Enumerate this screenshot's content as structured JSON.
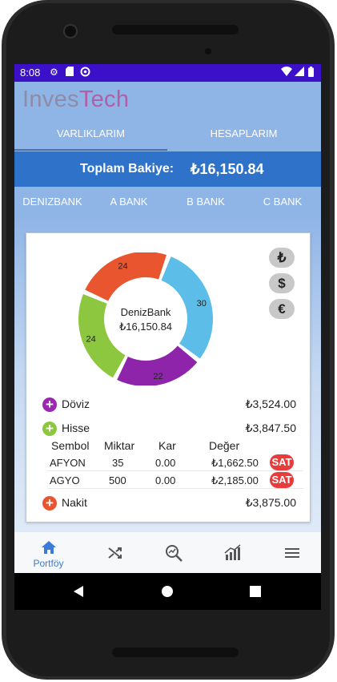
{
  "status_bar": {
    "time": "8:08"
  },
  "app": {
    "logo_part1": "Inves",
    "logo_part2": "Tech"
  },
  "main_tabs": [
    "VARLIKLARIM",
    "HESAPLARIM"
  ],
  "balance": {
    "label": "Toplam Bakiye:",
    "value": "₺16,150.84"
  },
  "bank_tabs": [
    "DENIZBANK",
    "A BANK",
    "B BANK",
    "C BANK"
  ],
  "chart_data": {
    "type": "pie",
    "center_title": "DenizBank",
    "center_value": "₺16,150.84",
    "slices": [
      {
        "value": 30,
        "label": "30",
        "color": "#5bbde8"
      },
      {
        "value": 22,
        "label": "22",
        "color": "#8e24aa"
      },
      {
        "value": 24,
        "label": "24",
        "color": "#8dc63f"
      },
      {
        "value": 24,
        "label": "24",
        "color": "#e9552f"
      }
    ]
  },
  "currency_buttons": [
    "₺",
    "$",
    "€"
  ],
  "categories": [
    {
      "name": "Döviz",
      "value": "₺3,524.00",
      "color": "#9c27b0"
    },
    {
      "name": "Hisse",
      "value": "₺3,847.50",
      "color": "#8dc63f"
    },
    {
      "name": "Nakit",
      "value": "₺3,875.00",
      "color": "#e9552f"
    }
  ],
  "table": {
    "headers": [
      "Sembol",
      "Miktar",
      "Kar",
      "Değer"
    ],
    "rows": [
      {
        "symbol": "AFYON",
        "amount": "35",
        "profit": "0.00",
        "value": "₺1,662.50",
        "action": "SAT"
      },
      {
        "symbol": "AGYO",
        "amount": "500",
        "profit": "0.00",
        "value": "₺2,185.00",
        "action": "SAT"
      }
    ]
  },
  "bottom_nav": {
    "active_label": "Portföy"
  },
  "colors": {
    "status_bar": "#3c10c8",
    "header": "#8fb4e6",
    "balance_bar": "#2e73c9",
    "nav_active": "#3b7ad8",
    "sell": "#e83c3c"
  }
}
